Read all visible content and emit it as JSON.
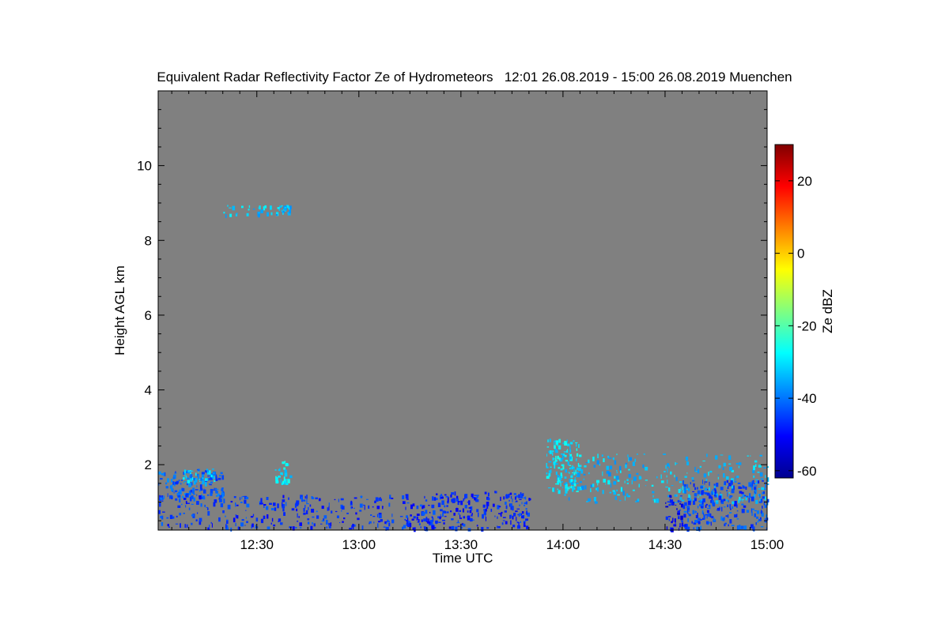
{
  "chart_data": {
    "type": "heatmap",
    "title": "Equivalent Radar Reflectivity Factor Ze of Hydrometeors   12:01 26.08.2019 - 15:00 26.08.2019 Muenchen",
    "xlabel": "Time UTC",
    "ylabel": "Height AGL km",
    "x_ticks": [
      "12:30",
      "13:00",
      "13:30",
      "14:00",
      "14:30",
      "15:00"
    ],
    "x_tick_minutes": [
      30,
      60,
      90,
      120,
      150,
      180
    ],
    "xlim_minutes_after_12": [
      1,
      180
    ],
    "y_ticks": [
      2,
      4,
      6,
      8,
      10
    ],
    "ylim": [
      0.25,
      12.0
    ],
    "background_color": "#808080",
    "colorbar": {
      "label": "Ze dBZ",
      "ticks": [
        20,
        0,
        -20,
        -40,
        -60
      ],
      "range": [
        -62,
        30
      ],
      "colors": [
        "#00008f",
        "#0000ff",
        "#0080ff",
        "#00ffff",
        "#80ff80",
        "#ffff00",
        "#ff8000",
        "#ff0000",
        "#800000"
      ]
    },
    "echoes": [
      {
        "t0": 1,
        "t1": 20,
        "h0": 1.1,
        "h1": 1.9,
        "ze": -42
      },
      {
        "t0": 8,
        "t1": 18,
        "h0": 1.5,
        "h1": 1.9,
        "ze": -32
      },
      {
        "t0": 1,
        "t1": 70,
        "h0": 0.3,
        "h1": 1.2,
        "ze": -46
      },
      {
        "t0": 20,
        "t1": 40,
        "h0": 8.7,
        "h1": 8.95,
        "ze": -33
      },
      {
        "t0": 35,
        "t1": 40,
        "h0": 1.5,
        "h1": 2.1,
        "ze": -30
      },
      {
        "t0": 72,
        "t1": 110,
        "h0": 0.3,
        "h1": 1.3,
        "ze": -47
      },
      {
        "t0": 115,
        "t1": 125,
        "h0": 1.3,
        "h1": 2.7,
        "ze": -30
      },
      {
        "t0": 120,
        "t1": 180,
        "h0": 1.0,
        "h1": 2.3,
        "ze": -33
      },
      {
        "t0": 150,
        "t1": 155,
        "h0": 0.3,
        "h1": 1.2,
        "ze": -50
      },
      {
        "t0": 155,
        "t1": 180,
        "h0": 0.3,
        "h1": 1.6,
        "ze": -44
      }
    ]
  }
}
